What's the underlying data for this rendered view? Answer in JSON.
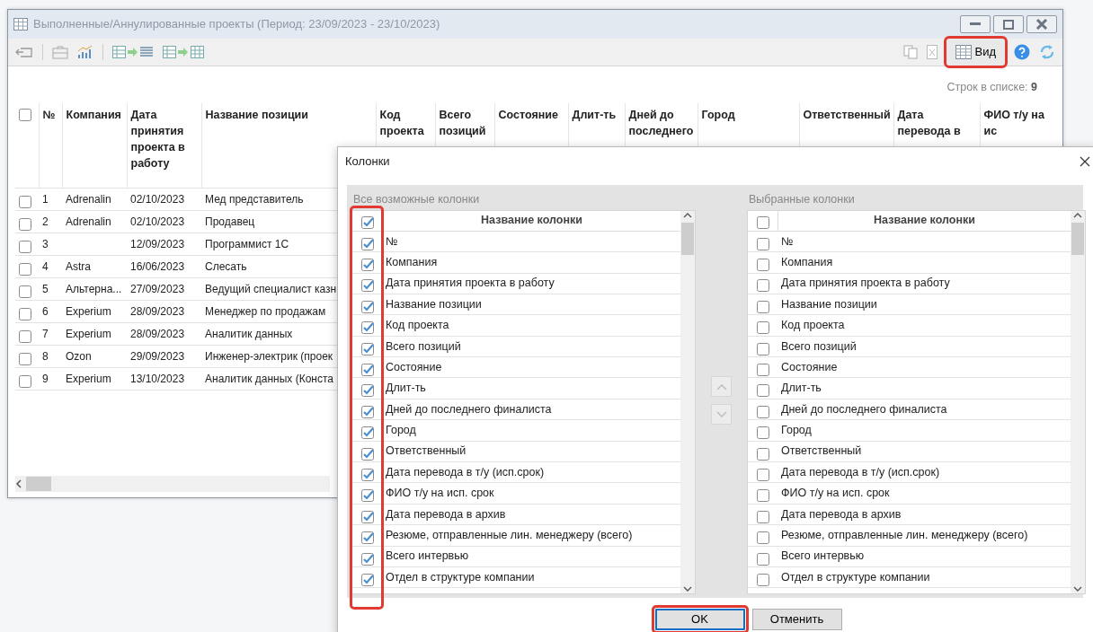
{
  "window": {
    "title": "Выполненные/Аннулированные проекты (Период: 23/09/2023 - 23/10/2023)",
    "toolbar": {
      "view_button": {
        "label": "Вид",
        "highlighted": true
      }
    },
    "row_count": {
      "label": "Строк в списке:",
      "value": "9"
    },
    "table": {
      "header_checked": false,
      "columns": [
        "№",
        "Компания",
        "Дата принятия проекта в работу",
        "Название позиции",
        "Код проекта",
        "Всего позиций",
        "Состояние",
        "Длит-ть",
        "Дней до последнего",
        "Город",
        "Ответственный",
        "Дата перевода в",
        "ФИО т/у на ис"
      ],
      "rows": [
        {
          "checked": false,
          "number": "1",
          "company": "Adrenalin",
          "date": "02/10/2023",
          "position": "Мед представитель"
        },
        {
          "checked": false,
          "number": "2",
          "company": "Adrenalin",
          "date": "02/10/2023",
          "position": "Продавец"
        },
        {
          "checked": false,
          "number": "3",
          "date": "12/09/2023",
          "position": "Программист 1С"
        },
        {
          "checked": false,
          "number": "4",
          "company": "Astra",
          "date": "16/06/2023",
          "position": "Слесать"
        },
        {
          "checked": false,
          "number": "5",
          "company": "Альтерна...",
          "date": "27/09/2023",
          "position": "Ведущий специалист казн"
        },
        {
          "checked": false,
          "number": "6",
          "company": "Experium",
          "date": "28/09/2023",
          "position": "Менеджер по продажам"
        },
        {
          "checked": false,
          "number": "7",
          "company": "Experium",
          "date": "28/09/2023",
          "position": "Аналитик данных"
        },
        {
          "checked": false,
          "number": "8",
          "company": "Ozon",
          "date": "29/09/2023",
          "position": "Инженер-электрик (проек"
        },
        {
          "checked": false,
          "number": "9",
          "company": "Experium",
          "date": "13/10/2023",
          "position": "Аналитик данных (Конста"
        }
      ]
    }
  },
  "dialog": {
    "title": "Колонки",
    "lists": [
      {
        "label": "Все возможные колонки",
        "header": "Название колонки",
        "header_checked": true,
        "checkboxes_highlighted": true,
        "items": [
          {
            "label": "№",
            "checked": true
          },
          {
            "label": "Компания",
            "checked": true
          },
          {
            "label": "Дата принятия проекта в работу",
            "checked": true
          },
          {
            "label": "Название позиции",
            "checked": true
          },
          {
            "label": "Код проекта",
            "checked": true
          },
          {
            "label": "Всего позиций",
            "checked": true
          },
          {
            "label": "Состояние",
            "checked": true
          },
          {
            "label": "Длит-ть",
            "checked": true
          },
          {
            "label": "Дней до последнего финалиста",
            "checked": true
          },
          {
            "label": "Город",
            "checked": true
          },
          {
            "label": "Ответственный",
            "checked": true
          },
          {
            "label": "Дата перевода в т/у (исп.срок)",
            "checked": true
          },
          {
            "label": "ФИО т/у на исп. срок",
            "checked": true
          },
          {
            "label": "Дата перевода в архив",
            "checked": true
          },
          {
            "label": "Резюме, отправленные лин. менеджеру (всего)",
            "checked": true
          },
          {
            "label": "Всего интервью",
            "checked": true
          },
          {
            "label": "Отдел в структуре компании",
            "checked": true
          }
        ]
      },
      {
        "label": "Выбранные колонки",
        "header": "Название колонки",
        "header_checked": false,
        "checkboxes_highlighted": false,
        "items": [
          {
            "label": "№",
            "checked": false
          },
          {
            "label": "Компания",
            "checked": false
          },
          {
            "label": "Дата принятия проекта в работу",
            "checked": false
          },
          {
            "label": "Название позиции",
            "checked": false
          },
          {
            "label": "Код проекта",
            "checked": false
          },
          {
            "label": "Всего позиций",
            "checked": false
          },
          {
            "label": "Состояние",
            "checked": false
          },
          {
            "label": "Длит-ть",
            "checked": false
          },
          {
            "label": "Дней до последнего финалиста",
            "checked": false
          },
          {
            "label": "Город",
            "checked": false
          },
          {
            "label": "Ответственный",
            "checked": false
          },
          {
            "label": "Дата перевода в т/у (исп.срок)",
            "checked": false
          },
          {
            "label": "ФИО т/у на исп. срок",
            "checked": false
          },
          {
            "label": "Дата перевода в архив",
            "checked": false
          },
          {
            "label": "Резюме, отправленные лин. менеджеру (всего)",
            "checked": false
          },
          {
            "label": "Всего интервью",
            "checked": false
          },
          {
            "label": "Отдел в структуре компании",
            "checked": false
          }
        ]
      }
    ],
    "buttons": [
      {
        "label": "OK",
        "kind": "primary",
        "highlighted": true
      },
      {
        "label": "Отменить",
        "kind": "secondary",
        "highlighted": false
      }
    ]
  }
}
